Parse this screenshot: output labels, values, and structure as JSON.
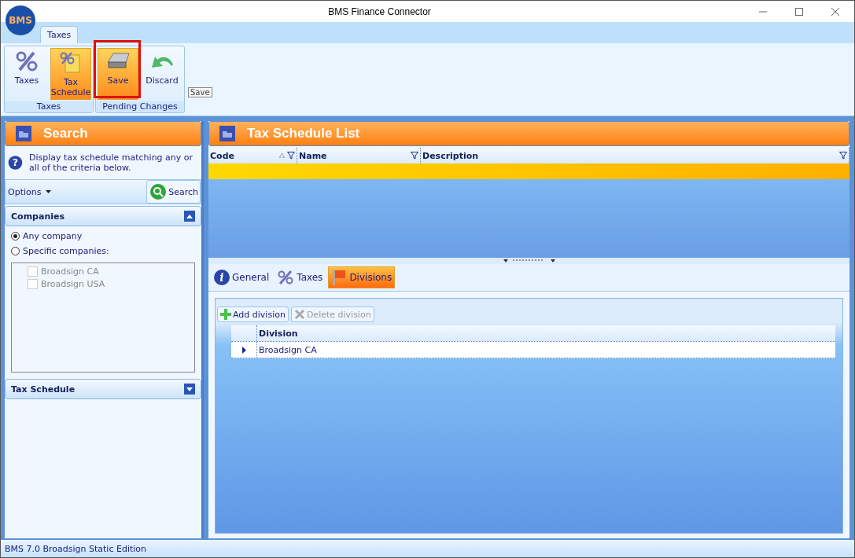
{
  "window": {
    "title": "BMS Finance Connector",
    "logo": "BMS"
  },
  "ribbon": {
    "tabs": [
      {
        "label": "Taxes",
        "selected": true
      }
    ],
    "groups": [
      {
        "label": "Taxes",
        "buttons": [
          {
            "label": "Taxes",
            "selected": false
          },
          {
            "label": "Tax Schedule",
            "selected": true
          }
        ]
      },
      {
        "label": "Pending Changes",
        "buttons": [
          {
            "label": "Save",
            "selected": true
          },
          {
            "label": "Discard",
            "selected": false
          }
        ]
      }
    ],
    "tooltip": "Save"
  },
  "search_panel": {
    "title": "Search",
    "help_glyph": "?",
    "hint": "Display tax schedule matching any or all of the criteria below.",
    "options_label": "Options",
    "search_button": "Search",
    "sections": [
      {
        "title": "Companies",
        "expanded": true,
        "choices": [
          {
            "label": "Any company",
            "selected": true
          },
          {
            "label": "Specific companies:",
            "selected": false
          }
        ],
        "companies": [
          {
            "label": "Broadsign CA",
            "checked": false
          },
          {
            "label": "Broadsign USA",
            "checked": false
          }
        ]
      },
      {
        "title": "Tax Schedule",
        "expanded": false
      }
    ]
  },
  "list_panel": {
    "title": "Tax Schedule List",
    "columns": [
      {
        "label": "Code",
        "sorted": true
      },
      {
        "label": "Name",
        "sorted": false
      },
      {
        "label": "Description",
        "sorted": false
      }
    ]
  },
  "detail_tabs": [
    {
      "label": "General",
      "icon_glyph": "i",
      "selected": false
    },
    {
      "label": "Taxes",
      "selected": false
    },
    {
      "label": "Divisions",
      "selected": true
    }
  ],
  "division_toolbar": [
    {
      "label": "Add division",
      "disabled": false
    },
    {
      "label": "Delete division",
      "disabled": true
    }
  ],
  "division_grid": {
    "column": "Division",
    "rows": [
      {
        "label": "Broadsign CA",
        "current": true
      }
    ]
  },
  "status_bar": "BMS 7.0 Broadsign Static Edition"
}
